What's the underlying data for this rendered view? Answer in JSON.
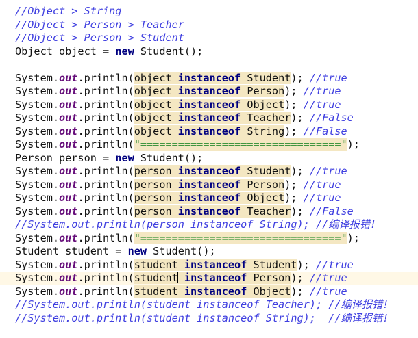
{
  "editor": {
    "current_line_index": 20,
    "colors": {
      "background": "#ffffff",
      "text": "#111111",
      "keyword": "#000080",
      "static_field": "#660e7a",
      "comment": "#3f3fe0",
      "string": "#067d17",
      "highlight": "#f4e7c2",
      "current_line": "#fff8e6"
    },
    "lines": [
      {
        "segments": [
          {
            "t": "comment",
            "text": "//Object > String"
          }
        ]
      },
      {
        "segments": [
          {
            "t": "comment",
            "text": "//Object > Person > Teacher"
          }
        ]
      },
      {
        "segments": [
          {
            "t": "comment",
            "text": "//Object > Person > Student"
          }
        ]
      },
      {
        "segments": [
          {
            "t": "plain",
            "text": "Object object = "
          },
          {
            "t": "kw",
            "text": "new"
          },
          {
            "t": "plain",
            "text": " Student();"
          }
        ]
      },
      {
        "segments": []
      },
      {
        "segments": [
          {
            "t": "plain",
            "text": "System."
          },
          {
            "t": "field",
            "text": "out"
          },
          {
            "t": "plain",
            "text": ".println("
          },
          {
            "t": "plain hl",
            "text": "object "
          },
          {
            "t": "kw hl",
            "text": "instanceof"
          },
          {
            "t": "plain hl",
            "text": " Student"
          },
          {
            "t": "plain",
            "text": "); "
          },
          {
            "t": "comment",
            "text": "//true"
          }
        ]
      },
      {
        "segments": [
          {
            "t": "plain",
            "text": "System."
          },
          {
            "t": "field",
            "text": "out"
          },
          {
            "t": "plain",
            "text": ".println("
          },
          {
            "t": "plain hl",
            "text": "object "
          },
          {
            "t": "kw hl",
            "text": "instanceof"
          },
          {
            "t": "plain hl",
            "text": " Person"
          },
          {
            "t": "plain",
            "text": "); "
          },
          {
            "t": "comment",
            "text": "//true"
          }
        ]
      },
      {
        "segments": [
          {
            "t": "plain",
            "text": "System."
          },
          {
            "t": "field",
            "text": "out"
          },
          {
            "t": "plain",
            "text": ".println("
          },
          {
            "t": "plain hl",
            "text": "object "
          },
          {
            "t": "kw hl",
            "text": "instanceof"
          },
          {
            "t": "plain hl",
            "text": " Object"
          },
          {
            "t": "plain",
            "text": "); "
          },
          {
            "t": "comment",
            "text": "//true"
          }
        ]
      },
      {
        "segments": [
          {
            "t": "plain",
            "text": "System."
          },
          {
            "t": "field",
            "text": "out"
          },
          {
            "t": "plain",
            "text": ".println("
          },
          {
            "t": "plain hl",
            "text": "object "
          },
          {
            "t": "kw hl",
            "text": "instanceof"
          },
          {
            "t": "plain hl",
            "text": " Teacher"
          },
          {
            "t": "plain",
            "text": "); "
          },
          {
            "t": "comment",
            "text": "//False"
          }
        ]
      },
      {
        "segments": [
          {
            "t": "plain",
            "text": "System."
          },
          {
            "t": "field",
            "text": "out"
          },
          {
            "t": "plain",
            "text": ".println("
          },
          {
            "t": "plain hl",
            "text": "object "
          },
          {
            "t": "kw hl",
            "text": "instanceof"
          },
          {
            "t": "plain hl",
            "text": " String"
          },
          {
            "t": "plain",
            "text": "); "
          },
          {
            "t": "comment",
            "text": "//False"
          }
        ]
      },
      {
        "segments": [
          {
            "t": "plain",
            "text": "System."
          },
          {
            "t": "field",
            "text": "out"
          },
          {
            "t": "plain",
            "text": ".println("
          },
          {
            "t": "str hl",
            "text": "\"================================\""
          },
          {
            "t": "plain",
            "text": ");"
          }
        ]
      },
      {
        "segments": [
          {
            "t": "plain",
            "text": "Person person = "
          },
          {
            "t": "kw",
            "text": "new"
          },
          {
            "t": "plain",
            "text": " Student();"
          }
        ]
      },
      {
        "segments": [
          {
            "t": "plain",
            "text": "System."
          },
          {
            "t": "field",
            "text": "out"
          },
          {
            "t": "plain",
            "text": ".println("
          },
          {
            "t": "plain hl",
            "text": "person "
          },
          {
            "t": "kw hl",
            "text": "instanceof"
          },
          {
            "t": "plain hl",
            "text": " Student"
          },
          {
            "t": "plain",
            "text": "); "
          },
          {
            "t": "comment",
            "text": "//true"
          }
        ]
      },
      {
        "segments": [
          {
            "t": "plain",
            "text": "System."
          },
          {
            "t": "field",
            "text": "out"
          },
          {
            "t": "plain",
            "text": ".println("
          },
          {
            "t": "plain hl",
            "text": "person "
          },
          {
            "t": "kw hl",
            "text": "instanceof"
          },
          {
            "t": "plain hl",
            "text": " Person"
          },
          {
            "t": "plain",
            "text": "); "
          },
          {
            "t": "comment",
            "text": "//true"
          }
        ]
      },
      {
        "segments": [
          {
            "t": "plain",
            "text": "System."
          },
          {
            "t": "field",
            "text": "out"
          },
          {
            "t": "plain",
            "text": ".println("
          },
          {
            "t": "plain hl",
            "text": "person "
          },
          {
            "t": "kw hl",
            "text": "instanceof"
          },
          {
            "t": "plain hl",
            "text": " Object"
          },
          {
            "t": "plain",
            "text": "); "
          },
          {
            "t": "comment",
            "text": "//true"
          }
        ]
      },
      {
        "segments": [
          {
            "t": "plain",
            "text": "System."
          },
          {
            "t": "field",
            "text": "out"
          },
          {
            "t": "plain",
            "text": ".println("
          },
          {
            "t": "plain hl",
            "text": "person "
          },
          {
            "t": "kw hl",
            "text": "instanceof"
          },
          {
            "t": "plain hl",
            "text": " Teacher"
          },
          {
            "t": "plain",
            "text": "); "
          },
          {
            "t": "comment",
            "text": "//False"
          }
        ]
      },
      {
        "segments": [
          {
            "t": "comment",
            "text": "//System.out.println(person instanceof String); //编译报错!"
          }
        ]
      },
      {
        "segments": [
          {
            "t": "plain",
            "text": "System."
          },
          {
            "t": "field",
            "text": "out"
          },
          {
            "t": "plain",
            "text": ".println("
          },
          {
            "t": "str hl",
            "text": "\"================================\""
          },
          {
            "t": "plain",
            "text": ");"
          }
        ]
      },
      {
        "segments": [
          {
            "t": "plain",
            "text": "Student student = "
          },
          {
            "t": "kw",
            "text": "new"
          },
          {
            "t": "plain",
            "text": " Student();"
          }
        ]
      },
      {
        "segments": [
          {
            "t": "plain",
            "text": "System."
          },
          {
            "t": "field",
            "text": "out"
          },
          {
            "t": "plain",
            "text": ".println("
          },
          {
            "t": "plain hl",
            "text": "student "
          },
          {
            "t": "kw hl",
            "text": "instanceof"
          },
          {
            "t": "plain hl",
            "text": " Student"
          },
          {
            "t": "plain",
            "text": "); "
          },
          {
            "t": "comment",
            "text": "//true"
          }
        ]
      },
      {
        "segments": [
          {
            "t": "plain",
            "text": "System."
          },
          {
            "t": "field",
            "text": "out"
          },
          {
            "t": "plain",
            "text": ".println("
          },
          {
            "t": "plain hl",
            "text": "student"
          },
          {
            "t": "caret",
            "text": ""
          },
          {
            "t": "plain hl",
            "text": " "
          },
          {
            "t": "kw hl",
            "text": "instanceof"
          },
          {
            "t": "plain hl",
            "text": " Person"
          },
          {
            "t": "plain",
            "text": "); "
          },
          {
            "t": "comment",
            "text": "//true"
          }
        ]
      },
      {
        "segments": [
          {
            "t": "plain",
            "text": "System."
          },
          {
            "t": "field",
            "text": "out"
          },
          {
            "t": "plain",
            "text": ".println("
          },
          {
            "t": "plain hl",
            "text": "student "
          },
          {
            "t": "kw hl",
            "text": "instanceof"
          },
          {
            "t": "plain hl",
            "text": " Object"
          },
          {
            "t": "plain",
            "text": "); "
          },
          {
            "t": "comment",
            "text": "//true"
          }
        ]
      },
      {
        "segments": [
          {
            "t": "comment",
            "text": "//System.out.println(student instanceof Teacher); //编译报错!"
          }
        ]
      },
      {
        "segments": [
          {
            "t": "comment",
            "text": "//System.out.println(student instanceof String);  //编译报错!"
          }
        ]
      }
    ]
  }
}
